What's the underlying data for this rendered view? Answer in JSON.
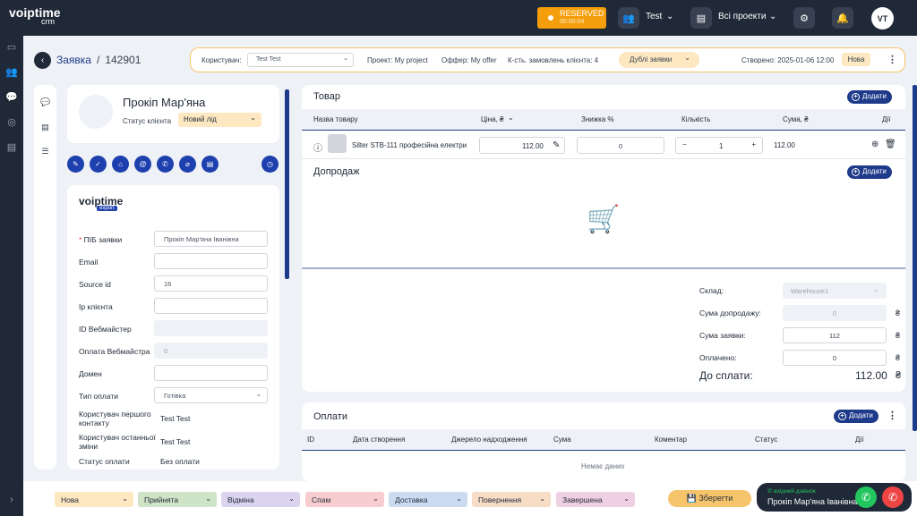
{
  "app": {
    "logo_main": "voiptime",
    "logo_sub": "crm"
  },
  "topbar": {
    "reserved_label": "RESERVED",
    "reserved_timer": "00:00:04",
    "team_label": "Test",
    "projects_label": "Всі проекти",
    "avatar_initials": "VT"
  },
  "breadcrumb": {
    "section": "Заявка",
    "separator": "/",
    "id": "142901"
  },
  "infobar": {
    "user_label": "Користувач:",
    "user_value": "Test Test",
    "project": "Проект: My project",
    "offer": "Оффер: My offer",
    "orders_count": "К-сть. замовлень клієнта: 4",
    "duplicates": "Дублі заявки",
    "created": "Створено: 2025-01-06 12:00",
    "status_badge": "Нова"
  },
  "client": {
    "name": "Прокіп Мар'яна",
    "status_label": "Статус клієнта",
    "status_value": "Новий лід"
  },
  "form": {
    "logo_main": "voiptime",
    "logo_sub": "export",
    "fio_label": "ПІБ заявки",
    "fio_value": "Прокіп Мар'яна Іванівна",
    "email_label": "Email",
    "email_value": "",
    "source_label": "Source id",
    "source_value": "16",
    "ip_label": "Ip клієнта",
    "webmaster_id_label": "ID Вебмайстер",
    "webmaster_pay_label": "Оплата Вебмайстра",
    "webmaster_pay_value": "0",
    "domain_label": "Домен",
    "pay_type_label": "Тип оплати",
    "pay_type_value": "Готівка",
    "first_user_label": "Користувач першого контакту",
    "first_user_value": "Test Test",
    "last_user_label": "Користувач останньої зміни",
    "last_user_value": "Test Test",
    "pay_status_label": "Статус оплати",
    "pay_status_value": "Без оплати"
  },
  "goods": {
    "title": "Товар",
    "add": "Додати",
    "headers": {
      "name": "Назва товару",
      "price": "Ціна, ₴",
      "discount": "Знижка %",
      "qty": "Кількість",
      "sum": "Сума, ₴",
      "actions": "Дії"
    },
    "row": {
      "name": "Silter STB-111 професійна електри",
      "price": "112.00",
      "discount": "0",
      "qty": "1",
      "sum": "112.00"
    }
  },
  "upsell": {
    "title": "Допродаж",
    "add": "Додати"
  },
  "summary": {
    "warehouse_label": "Склад:",
    "warehouse_value": "Warehouse1",
    "upsell_sum_label": "Сума допродажу:",
    "upsell_sum_value": "0",
    "order_sum_label": "Сума заявки:",
    "order_sum_value": "112",
    "paid_label": "Оплачено:",
    "paid_value": "0",
    "to_pay_label": "До сплати:",
    "to_pay_value": "112.00",
    "currency": "₴"
  },
  "payments": {
    "title": "Оплати",
    "add": "Додати",
    "headers": {
      "id": "ID",
      "date": "Дата створення",
      "source": "Джерело надходження",
      "sum": "Сума",
      "comment": "Коментар",
      "status": "Статус",
      "actions": "Дії"
    },
    "empty": "Немає даних"
  },
  "statuses": [
    {
      "label": "Нова",
      "color": "#fde8c2"
    },
    {
      "label": "Прийнята",
      "color": "#cfe3c6"
    },
    {
      "label": "Відміна",
      "color": "#dcd3ef"
    },
    {
      "label": "Спам",
      "color": "#f7cdd0"
    },
    {
      "label": "Доставка",
      "color": "#cbdcf2"
    },
    {
      "label": "Повернення",
      "color": "#f7dcc6"
    },
    {
      "label": "Завершена",
      "color": "#efcfe4"
    }
  ],
  "save_label": "Зберегти",
  "call": {
    "incoming": "вхідний дзвінок",
    "name": "Прокіп Мар'яна Іванівна"
  }
}
